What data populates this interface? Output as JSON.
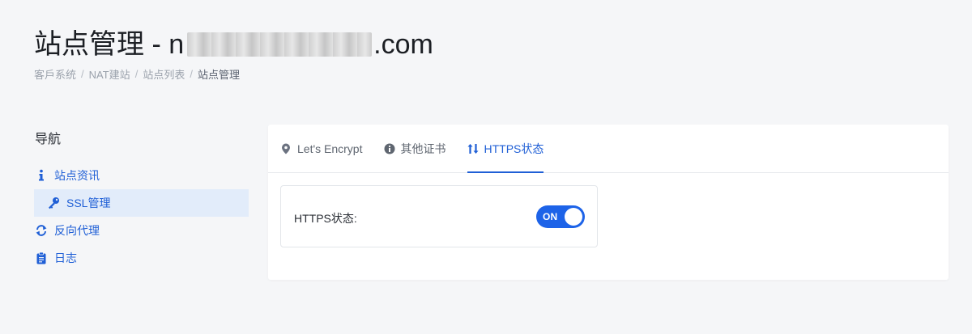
{
  "header": {
    "title_prefix": "站点管理 - n",
    "title_suffix": ".com",
    "breadcrumb": [
      {
        "label": "客戶系统"
      },
      {
        "label": "NAT建站"
      },
      {
        "label": "站点列表"
      },
      {
        "label": "站点管理"
      }
    ],
    "separator": "/"
  },
  "sidebar": {
    "title": "导航",
    "items": [
      {
        "label": "站点资讯",
        "icon": "info-icon",
        "active": false
      },
      {
        "label": "SSL管理",
        "icon": "key-icon",
        "active": true
      },
      {
        "label": "反向代理",
        "icon": "sync-icon",
        "active": false
      },
      {
        "label": "日志",
        "icon": "clipboard-icon",
        "active": false
      }
    ]
  },
  "tabs": [
    {
      "label": "Let's Encrypt",
      "icon": "map-marker-icon",
      "active": false
    },
    {
      "label": "其他证书",
      "icon": "info-circle-icon",
      "active": false
    },
    {
      "label": "HTTPS状态",
      "icon": "sort-arrows-icon",
      "active": true
    }
  ],
  "https": {
    "label": "HTTPS状态:",
    "toggle_text": "ON",
    "enabled": true
  },
  "colors": {
    "accent": "#1f5fd6",
    "toggle": "#1d63e8",
    "background": "#f5f6f8",
    "active_nav_bg": "#e2ecfa"
  }
}
